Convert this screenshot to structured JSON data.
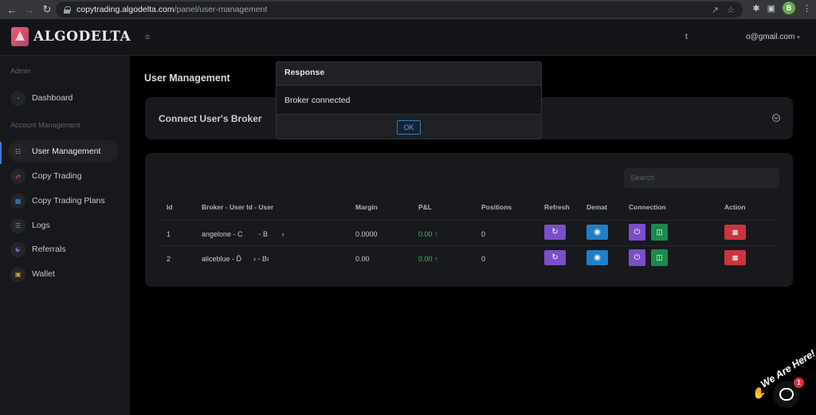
{
  "browser": {
    "url_host": "copytrading.algodelta.com",
    "url_path": "/panel/user-management",
    "profile_initial": "B"
  },
  "header": {
    "logo_text": "ALGODELTA",
    "user_initial": "t",
    "user_email": "o@gmail.com"
  },
  "sidebar": {
    "sections": [
      {
        "heading": "Admin"
      },
      {
        "heading": "Account Management"
      }
    ],
    "items": [
      {
        "label": "Dashboard",
        "icon": "gauge-icon"
      },
      {
        "label": "User Management",
        "icon": "users-icon",
        "active": true
      },
      {
        "label": "Copy Trading",
        "icon": "copy-icon"
      },
      {
        "label": "Copy Trading Plans",
        "icon": "plans-icon"
      },
      {
        "label": "Logs",
        "icon": "logs-icon"
      },
      {
        "label": "Referrals",
        "icon": "referrals-icon"
      },
      {
        "label": "Wallet",
        "icon": "wallet-icon"
      }
    ]
  },
  "main": {
    "page_title": "User Management",
    "connect_card_title": "Connect User's Broker",
    "search_placeholder": "Search",
    "table": {
      "headers": [
        "Id",
        "Broker - User Id - User",
        "Margin",
        "P&L",
        "Positions",
        "Refresh",
        "Demat",
        "Connection",
        "Action"
      ],
      "rows": [
        {
          "id": "1",
          "broker": "angelone - C        - B       ›",
          "margin": "0.0000",
          "pnl": "0.00 ↑",
          "positions": "0"
        },
        {
          "id": "2",
          "broker": "aliceblue - Ď      › - Bı",
          "margin": "0.00",
          "pnl": "0.00 ↑",
          "positions": "0"
        }
      ]
    }
  },
  "modal": {
    "title": "Response",
    "message": "Broker connected",
    "ok_label": "OK"
  },
  "chat": {
    "label": "We Are Here!",
    "badge_count": "1"
  },
  "colors": {
    "refresh": "#7a4fc9",
    "demat": "#1f7fc9",
    "connect": "#1c8a4e",
    "delete": "#c9353f",
    "pnl_positive": "#2fbf71",
    "accent": "#3a7bd5"
  }
}
